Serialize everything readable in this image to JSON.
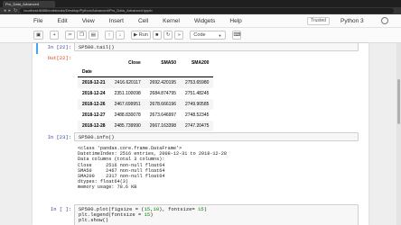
{
  "browser": {
    "tab_title": "Pro_Data_Advanced",
    "url": "localhost:8888/notebooks/Desktop/Python/Advanced/Pro_Data_Advanced.ipynb"
  },
  "menu": {
    "items": [
      "File",
      "Edit",
      "View",
      "Insert",
      "Cell",
      "Kernel",
      "Widgets",
      "Help"
    ],
    "trusted": "Trusted",
    "kernel": "Python 3"
  },
  "toolbar": {
    "run_label": "Run",
    "cell_type": "Code"
  },
  "cells": {
    "c22": {
      "in_prompt": "In [22]:",
      "code": "SP500.tail()",
      "out_prompt": "Out[22]:"
    },
    "c23": {
      "in_prompt": "In [23]:",
      "code": "SP500.info()",
      "output": "<class 'pandas.core.frame.DataFrame'>\nDatetimeIndex: 2516 entries, 2008-12-31 to 2018-12-28\nData columns (total 3 columns):\nClose     2516 non-null float64\nSMA50     2467 non-null float64\nSMA200    2317 non-null float64\ndtypes: float64(3)\nmemory usage: 78.6 KB"
    },
    "c24": {
      "in_prompt": "In [ ]:"
    }
  },
  "dataframe": {
    "columns": [
      "Close",
      "SMA50",
      "SMA200"
    ],
    "index_name": "Date",
    "rows": [
      {
        "date": "2018-12-21",
        "values": [
          "2416.620117",
          "2692.420195",
          "2753.65980"
        ]
      },
      {
        "date": "2018-12-24",
        "values": [
          "2351.100098",
          "2684.874795",
          "2751.48245"
        ]
      },
      {
        "date": "2018-12-26",
        "values": [
          "2467.699951",
          "2678.666196",
          "2749.90585"
        ]
      },
      {
        "date": "2018-12-27",
        "values": [
          "2488.830078",
          "2673.646997",
          "2748.52345"
        ]
      },
      {
        "date": "2018-12-28",
        "values": [
          "2485.739990",
          "2667.163398",
          "2747.20475"
        ]
      }
    ]
  }
}
